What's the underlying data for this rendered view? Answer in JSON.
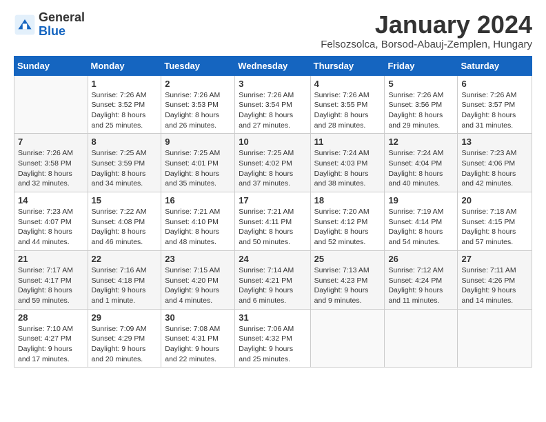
{
  "header": {
    "logo_general": "General",
    "logo_blue": "Blue",
    "title": "January 2024",
    "subtitle": "Felsozsolca, Borsod-Abauj-Zemplen, Hungary"
  },
  "weekdays": [
    "Sunday",
    "Monday",
    "Tuesday",
    "Wednesday",
    "Thursday",
    "Friday",
    "Saturday"
  ],
  "weeks": [
    [
      {
        "day": "",
        "info": ""
      },
      {
        "day": "1",
        "info": "Sunrise: 7:26 AM\nSunset: 3:52 PM\nDaylight: 8 hours\nand 25 minutes."
      },
      {
        "day": "2",
        "info": "Sunrise: 7:26 AM\nSunset: 3:53 PM\nDaylight: 8 hours\nand 26 minutes."
      },
      {
        "day": "3",
        "info": "Sunrise: 7:26 AM\nSunset: 3:54 PM\nDaylight: 8 hours\nand 27 minutes."
      },
      {
        "day": "4",
        "info": "Sunrise: 7:26 AM\nSunset: 3:55 PM\nDaylight: 8 hours\nand 28 minutes."
      },
      {
        "day": "5",
        "info": "Sunrise: 7:26 AM\nSunset: 3:56 PM\nDaylight: 8 hours\nand 29 minutes."
      },
      {
        "day": "6",
        "info": "Sunrise: 7:26 AM\nSunset: 3:57 PM\nDaylight: 8 hours\nand 31 minutes."
      }
    ],
    [
      {
        "day": "7",
        "info": "Sunrise: 7:26 AM\nSunset: 3:58 PM\nDaylight: 8 hours\nand 32 minutes."
      },
      {
        "day": "8",
        "info": "Sunrise: 7:25 AM\nSunset: 3:59 PM\nDaylight: 8 hours\nand 34 minutes."
      },
      {
        "day": "9",
        "info": "Sunrise: 7:25 AM\nSunset: 4:01 PM\nDaylight: 8 hours\nand 35 minutes."
      },
      {
        "day": "10",
        "info": "Sunrise: 7:25 AM\nSunset: 4:02 PM\nDaylight: 8 hours\nand 37 minutes."
      },
      {
        "day": "11",
        "info": "Sunrise: 7:24 AM\nSunset: 4:03 PM\nDaylight: 8 hours\nand 38 minutes."
      },
      {
        "day": "12",
        "info": "Sunrise: 7:24 AM\nSunset: 4:04 PM\nDaylight: 8 hours\nand 40 minutes."
      },
      {
        "day": "13",
        "info": "Sunrise: 7:23 AM\nSunset: 4:06 PM\nDaylight: 8 hours\nand 42 minutes."
      }
    ],
    [
      {
        "day": "14",
        "info": "Sunrise: 7:23 AM\nSunset: 4:07 PM\nDaylight: 8 hours\nand 44 minutes."
      },
      {
        "day": "15",
        "info": "Sunrise: 7:22 AM\nSunset: 4:08 PM\nDaylight: 8 hours\nand 46 minutes."
      },
      {
        "day": "16",
        "info": "Sunrise: 7:21 AM\nSunset: 4:10 PM\nDaylight: 8 hours\nand 48 minutes."
      },
      {
        "day": "17",
        "info": "Sunrise: 7:21 AM\nSunset: 4:11 PM\nDaylight: 8 hours\nand 50 minutes."
      },
      {
        "day": "18",
        "info": "Sunrise: 7:20 AM\nSunset: 4:12 PM\nDaylight: 8 hours\nand 52 minutes."
      },
      {
        "day": "19",
        "info": "Sunrise: 7:19 AM\nSunset: 4:14 PM\nDaylight: 8 hours\nand 54 minutes."
      },
      {
        "day": "20",
        "info": "Sunrise: 7:18 AM\nSunset: 4:15 PM\nDaylight: 8 hours\nand 57 minutes."
      }
    ],
    [
      {
        "day": "21",
        "info": "Sunrise: 7:17 AM\nSunset: 4:17 PM\nDaylight: 8 hours\nand 59 minutes."
      },
      {
        "day": "22",
        "info": "Sunrise: 7:16 AM\nSunset: 4:18 PM\nDaylight: 9 hours\nand 1 minute."
      },
      {
        "day": "23",
        "info": "Sunrise: 7:15 AM\nSunset: 4:20 PM\nDaylight: 9 hours\nand 4 minutes."
      },
      {
        "day": "24",
        "info": "Sunrise: 7:14 AM\nSunset: 4:21 PM\nDaylight: 9 hours\nand 6 minutes."
      },
      {
        "day": "25",
        "info": "Sunrise: 7:13 AM\nSunset: 4:23 PM\nDaylight: 9 hours\nand 9 minutes."
      },
      {
        "day": "26",
        "info": "Sunrise: 7:12 AM\nSunset: 4:24 PM\nDaylight: 9 hours\nand 11 minutes."
      },
      {
        "day": "27",
        "info": "Sunrise: 7:11 AM\nSunset: 4:26 PM\nDaylight: 9 hours\nand 14 minutes."
      }
    ],
    [
      {
        "day": "28",
        "info": "Sunrise: 7:10 AM\nSunset: 4:27 PM\nDaylight: 9 hours\nand 17 minutes."
      },
      {
        "day": "29",
        "info": "Sunrise: 7:09 AM\nSunset: 4:29 PM\nDaylight: 9 hours\nand 20 minutes."
      },
      {
        "day": "30",
        "info": "Sunrise: 7:08 AM\nSunset: 4:31 PM\nDaylight: 9 hours\nand 22 minutes."
      },
      {
        "day": "31",
        "info": "Sunrise: 7:06 AM\nSunset: 4:32 PM\nDaylight: 9 hours\nand 25 minutes."
      },
      {
        "day": "",
        "info": ""
      },
      {
        "day": "",
        "info": ""
      },
      {
        "day": "",
        "info": ""
      }
    ]
  ]
}
